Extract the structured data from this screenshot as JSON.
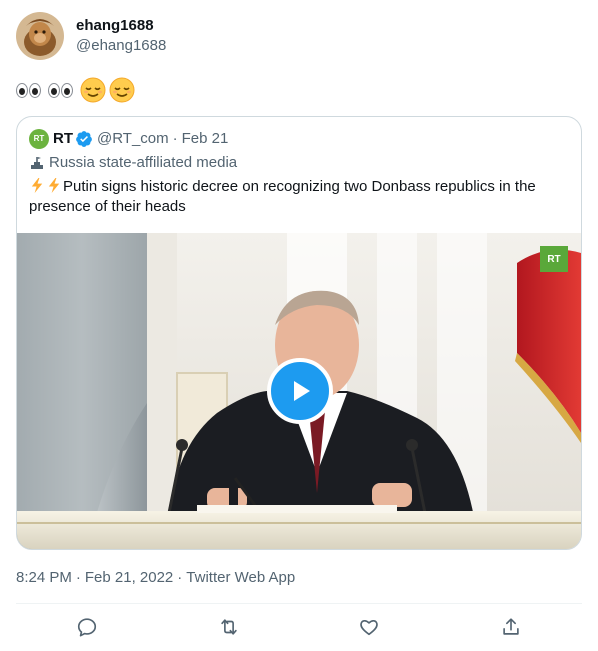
{
  "tweet": {
    "display_name": "ehang1688",
    "handle": "@ehang1688",
    "avatar_icon": "avatar-icon",
    "emoji": [
      "eyes-emoji",
      "eyes-emoji",
      "relieved-face-emoji",
      "relieved-face-emoji"
    ],
    "timestamp": {
      "time": "8:24 PM",
      "sep1": "·",
      "date": "Feb 21, 2022",
      "sep2": "·",
      "source": "Twitter Web App"
    }
  },
  "quoted": {
    "logo_text": "RT",
    "name": "RT",
    "handle": "@RT_com",
    "sep": "·",
    "date": "Feb 21",
    "affiliation": "Russia state-affiliated media",
    "text": "Putin signs historic decree on recognizing two Donbass republics in the presence of their heads",
    "text_prefix_icons": [
      "lightning-emoji",
      "lightning-emoji"
    ],
    "media": {
      "type": "video",
      "watermark": "RT"
    }
  },
  "actions": [
    "reply-icon",
    "retweet-icon",
    "like-icon",
    "share-icon"
  ],
  "colors": {
    "accent": "#1d9bf0",
    "secondary_text": "#536471",
    "rt_green": "#6cb33f"
  }
}
